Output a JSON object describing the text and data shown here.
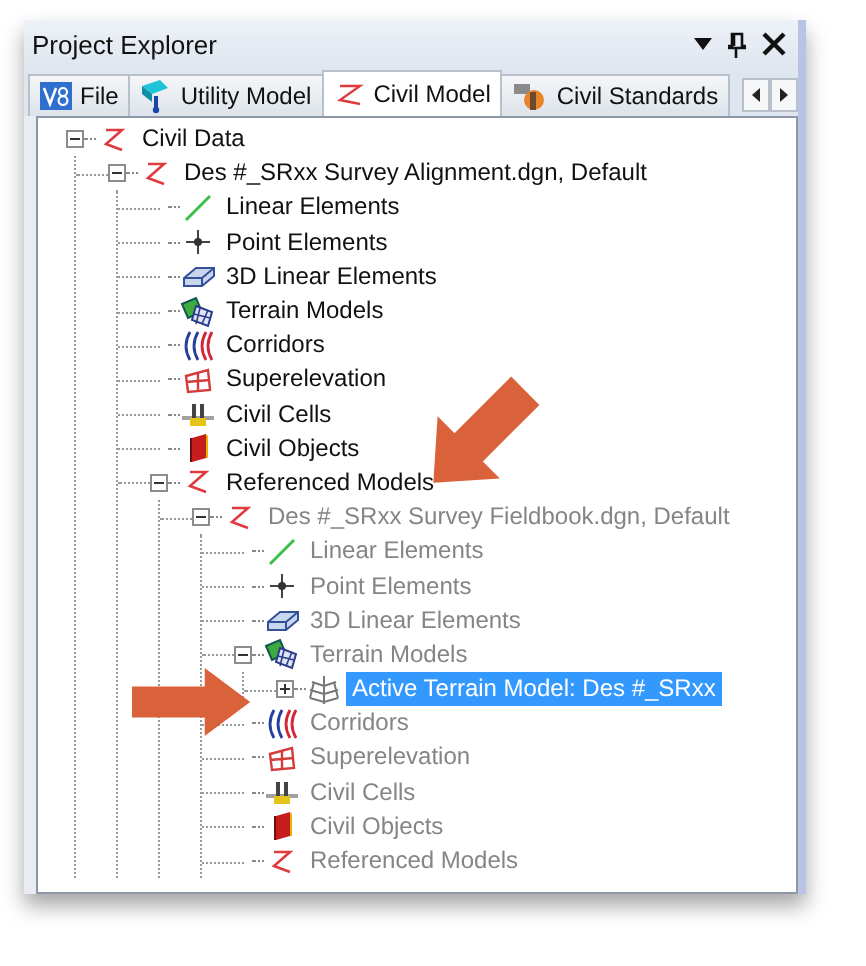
{
  "window": {
    "title": "Project Explorer"
  },
  "tabs": [
    {
      "label": "File",
      "kind": "file",
      "selected": false
    },
    {
      "label": "Utility Model",
      "kind": "utility",
      "selected": false
    },
    {
      "label": "Civil Model",
      "kind": "civil",
      "selected": true
    },
    {
      "label": "Civil Standards",
      "kind": "standards",
      "selected": false
    }
  ],
  "tree": [
    {
      "label": "Civil Data",
      "kind": "civil",
      "expanded": true,
      "selected": false,
      "disabled": false,
      "children": [
        {
          "label": "Des #_SRxx Survey Alignment.dgn, Default",
          "kind": "civil",
          "expanded": true,
          "selected": false,
          "disabled": false,
          "children": [
            {
              "label": "Linear Elements",
              "kind": "linear",
              "selected": false,
              "disabled": false
            },
            {
              "label": "Point Elements",
              "kind": "point",
              "selected": false,
              "disabled": false
            },
            {
              "label": "3D Linear Elements",
              "kind": "linear3d",
              "selected": false,
              "disabled": false
            },
            {
              "label": "Terrain Models",
              "kind": "terrain",
              "selected": false,
              "disabled": false
            },
            {
              "label": "Corridors",
              "kind": "corridor",
              "selected": false,
              "disabled": false
            },
            {
              "label": "Superelevation",
              "kind": "superelevation",
              "selected": false,
              "disabled": false
            },
            {
              "label": "Civil Cells",
              "kind": "cells",
              "selected": false,
              "disabled": false
            },
            {
              "label": "Civil Objects",
              "kind": "objects",
              "selected": false,
              "disabled": false
            },
            {
              "label": "Referenced Models",
              "kind": "civil",
              "expanded": true,
              "selected": false,
              "disabled": false,
              "children": [
                {
                  "label": "Des #_SRxx Survey Fieldbook.dgn, Default",
                  "kind": "civil",
                  "expanded": true,
                  "selected": false,
                  "disabled": true,
                  "children": [
                    {
                      "label": "Linear Elements",
                      "kind": "linear",
                      "selected": false,
                      "disabled": true
                    },
                    {
                      "label": "Point Elements",
                      "kind": "point",
                      "selected": false,
                      "disabled": true
                    },
                    {
                      "label": "3D Linear Elements",
                      "kind": "linear3d",
                      "selected": false,
                      "disabled": true
                    },
                    {
                      "label": "Terrain Models",
                      "kind": "terrain",
                      "expanded": true,
                      "selected": false,
                      "disabled": true,
                      "children": [
                        {
                          "label": "Active Terrain Model: Des #_SRxx",
                          "kind": "mesh",
                          "expanded": false,
                          "selected": true
                        }
                      ]
                    },
                    {
                      "label": "Corridors",
                      "kind": "corridor",
                      "selected": false,
                      "disabled": true
                    },
                    {
                      "label": "Superelevation",
                      "kind": "superelevation",
                      "selected": false,
                      "disabled": true
                    },
                    {
                      "label": "Civil Cells",
                      "kind": "cells",
                      "selected": false,
                      "disabled": true
                    },
                    {
                      "label": "Civil Objects",
                      "kind": "objects",
                      "selected": false,
                      "disabled": true
                    },
                    {
                      "label": "Referenced Models",
                      "kind": "civil",
                      "selected": false,
                      "disabled": true
                    }
                  ]
                }
              ]
            }
          ]
        }
      ]
    }
  ]
}
